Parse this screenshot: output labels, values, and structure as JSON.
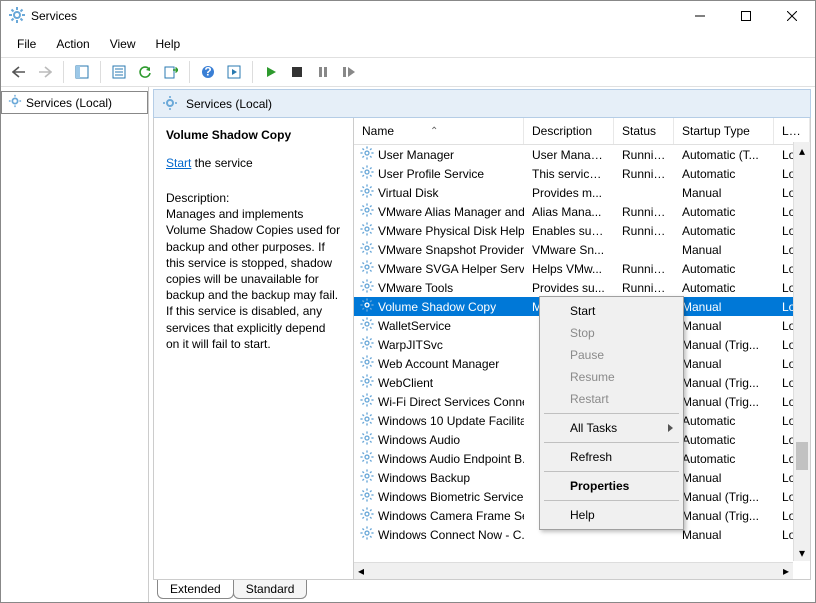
{
  "titlebar": {
    "title": "Services"
  },
  "menu": {
    "file": "File",
    "action": "Action",
    "view": "View",
    "help": "Help"
  },
  "nav": {
    "label": "Services (Local)"
  },
  "header": {
    "label": "Services (Local)"
  },
  "left": {
    "selected_name": "Volume Shadow Copy",
    "start_link": "Start",
    "start_suffix": " the service",
    "desc_label": "Description:",
    "desc_text": "Manages and implements Volume Shadow Copies used for backup and other purposes. If this service is stopped, shadow copies will be unavailable for backup and the backup may fail. If this service is disabled, any services that explicitly depend on it will fail to start."
  },
  "columns": {
    "name": "Name",
    "desc": "Description",
    "status": "Status",
    "stype": "Startup Type",
    "log": "Log"
  },
  "services": [
    {
      "name": "User Manager",
      "desc": "User Manag...",
      "status": "Running",
      "stype": "Automatic (T...",
      "log": "Loc"
    },
    {
      "name": "User Profile Service",
      "desc": "This service ...",
      "status": "Running",
      "stype": "Automatic",
      "log": "Loc"
    },
    {
      "name": "Virtual Disk",
      "desc": "Provides m...",
      "status": "",
      "stype": "Manual",
      "log": "Loc"
    },
    {
      "name": "VMware Alias Manager and ...",
      "desc": "Alias Mana...",
      "status": "Running",
      "stype": "Automatic",
      "log": "Loc"
    },
    {
      "name": "VMware Physical Disk Help...",
      "desc": "Enables sup...",
      "status": "Running",
      "stype": "Automatic",
      "log": "Loc"
    },
    {
      "name": "VMware Snapshot Provider",
      "desc": "VMware Sn...",
      "status": "",
      "stype": "Manual",
      "log": "Loc"
    },
    {
      "name": "VMware SVGA Helper Service",
      "desc": "Helps VMw...",
      "status": "Running",
      "stype": "Automatic",
      "log": "Loc"
    },
    {
      "name": "VMware Tools",
      "desc": "Provides su...",
      "status": "Running",
      "stype": "Automatic",
      "log": "Loc"
    },
    {
      "name": "Volume Shadow Copy",
      "desc": "Manages an",
      "status": "",
      "stype": "Manual",
      "log": "Loc"
    },
    {
      "name": "WalletService",
      "desc": "",
      "status": "",
      "stype": "Manual",
      "log": "Loc"
    },
    {
      "name": "WarpJITSvc",
      "desc": "",
      "status": "",
      "stype": "Manual (Trig...",
      "log": "Loc"
    },
    {
      "name": "Web Account Manager",
      "desc": "",
      "status": "",
      "stype": "Manual",
      "log": "Loc"
    },
    {
      "name": "WebClient",
      "desc": "",
      "status": "",
      "stype": "Manual (Trig...",
      "log": "Loc"
    },
    {
      "name": "Wi-Fi Direct Services Conne...",
      "desc": "",
      "status": "",
      "stype": "Manual (Trig...",
      "log": "Loc"
    },
    {
      "name": "Windows 10 Update Facilita...",
      "desc": "",
      "status": "",
      "stype": "Automatic",
      "log": "Loc"
    },
    {
      "name": "Windows Audio",
      "desc": "",
      "status": "",
      "stype": "Automatic",
      "log": "Loc"
    },
    {
      "name": "Windows Audio Endpoint B...",
      "desc": "",
      "status": "",
      "stype": "Automatic",
      "log": "Loc"
    },
    {
      "name": "Windows Backup",
      "desc": "",
      "status": "",
      "stype": "Manual",
      "log": "Loc"
    },
    {
      "name": "Windows Biometric Service",
      "desc": "",
      "status": "",
      "stype": "Manual (Trig...",
      "log": "Loc"
    },
    {
      "name": "Windows Camera Frame Se...",
      "desc": "",
      "status": "",
      "stype": "Manual (Trig...",
      "log": "Loc"
    },
    {
      "name": "Windows Connect Now - C...",
      "desc": "",
      "status": "",
      "stype": "Manual",
      "log": "Loc"
    }
  ],
  "selected_index": 8,
  "context_menu": {
    "start": "Start",
    "stop": "Stop",
    "pause": "Pause",
    "resume": "Resume",
    "restart": "Restart",
    "alltasks": "All Tasks",
    "refresh": "Refresh",
    "properties": "Properties",
    "help": "Help"
  },
  "tabs": {
    "extended": "Extended",
    "standard": "Standard"
  }
}
